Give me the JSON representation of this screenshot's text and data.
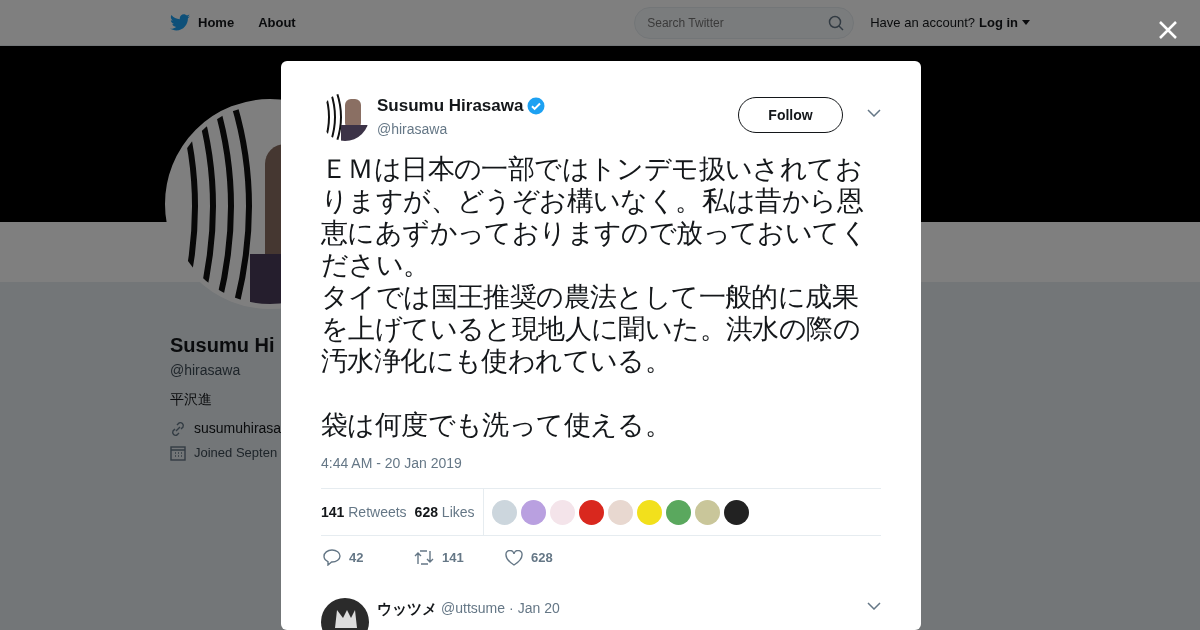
{
  "topbar": {
    "nav": [
      {
        "label": "Home"
      },
      {
        "label": "About"
      }
    ],
    "search": {
      "placeholder": "Search Twitter"
    },
    "account_prompt": "Have an account?",
    "login": "Log in"
  },
  "profile": {
    "name": "Susumu Hi",
    "handle": "@hirasawa",
    "bio": "平沢進",
    "link": "susumuhirasa",
    "joined": "Joined Septen"
  },
  "tweet": {
    "author": {
      "name": "Susumu Hirasawa",
      "handle": "@hirasawa",
      "verified": true
    },
    "follow_button": "Follow",
    "paragraphs": [
      "ＥＭは日本の一部ではトンデモ扱いされておりますが、どうぞお構いなく。私は昔から恩恵にあずかっておりますので放っておいてください。",
      "タイでは国王推奨の農法として一般的に成果を上げていると現地人に聞いた。洪水の際の汚水浄化にも使われている。",
      "袋は何度でも洗って使える。"
    ],
    "timestamp": "4:44 AM - 20 Jan 2019",
    "stats": [
      {
        "count": "141",
        "label": "Retweets"
      },
      {
        "count": "628",
        "label": "Likes"
      }
    ],
    "likers": [
      {
        "color": "#ccd6dd"
      },
      {
        "color": "#b9a0e0"
      },
      {
        "color": "#f4e4ea"
      },
      {
        "color": "#d9281e"
      },
      {
        "color": "#e8d8d0"
      },
      {
        "color": "#f2e01c"
      },
      {
        "color": "#5aa85e"
      },
      {
        "color": "#c9c69a"
      },
      {
        "color": "#222222"
      }
    ],
    "actions": [
      {
        "kind": "reply",
        "count": "42"
      },
      {
        "kind": "retweet",
        "count": "141"
      },
      {
        "kind": "like",
        "count": "628"
      }
    ]
  },
  "reply": {
    "name": "ウッツメ",
    "handle": "@uttsume",
    "separator": "·",
    "date": "Jan 20"
  }
}
